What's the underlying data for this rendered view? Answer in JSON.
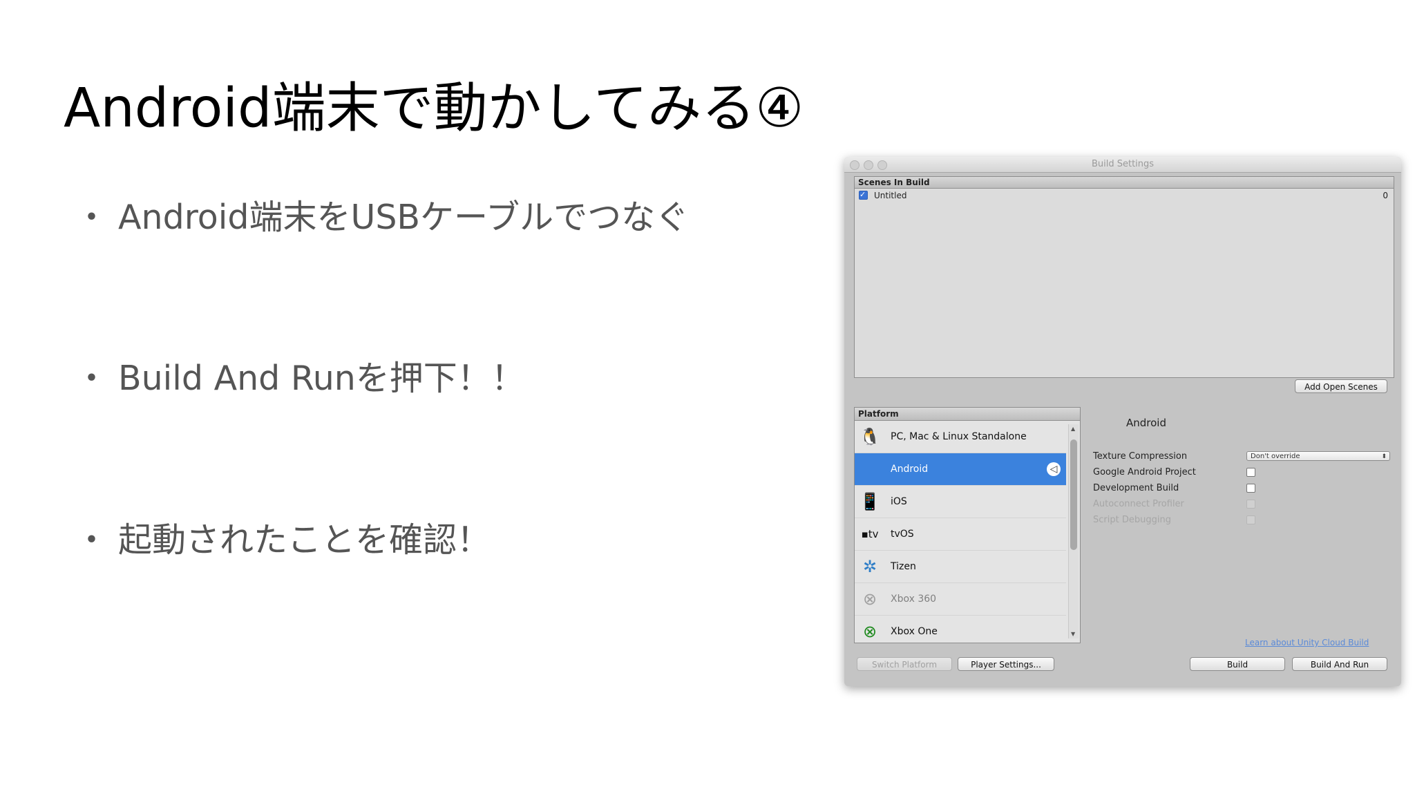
{
  "slide": {
    "title": "Android端末で動かしてみる④",
    "bullet_marker": "・",
    "bullets": [
      "Android端末をUSBケーブルでつなぐ",
      "Build And Runを押下！！",
      "起動されたことを確認！"
    ]
  },
  "window": {
    "title": "Build Settings",
    "scenes": {
      "header": "Scenes In Build",
      "items": [
        {
          "name": "Untitled",
          "index": "0",
          "checked": true
        }
      ],
      "add_open_scenes_label": "Add Open Scenes"
    },
    "platform": {
      "header": "Platform",
      "items": [
        {
          "label": "PC, Mac & Linux Standalone",
          "icon": "standalone-icon"
        },
        {
          "label": "Android",
          "icon": "android-icon",
          "selected": true
        },
        {
          "label": "iOS",
          "icon": "ios-icon"
        },
        {
          "label": "tvOS",
          "icon": "tvos-icon"
        },
        {
          "label": "Tizen",
          "icon": "tizen-icon"
        },
        {
          "label": "Xbox 360",
          "icon": "xbox-360-icon"
        },
        {
          "label": "Xbox One",
          "icon": "xbox-one-icon"
        }
      ]
    },
    "settings": {
      "title": "Android",
      "texture_compression_label": "Texture Compression",
      "texture_compression_value": "Don't override",
      "google_android_project_label": "Google Android Project",
      "development_build_label": "Development Build",
      "autoconnect_profiler_label": "Autoconnect Profiler",
      "script_debugging_label": "Script Debugging",
      "cloud_build_link": "Learn about Unity Cloud Build"
    },
    "buttons": {
      "switch_platform": "Switch Platform",
      "player_settings": "Player Settings...",
      "build": "Build",
      "build_and_run": "Build And Run"
    }
  },
  "colors": {
    "selected_row": "#3b82dd",
    "link": "#5a8ad8",
    "window_bg": "#c4c4c4"
  }
}
